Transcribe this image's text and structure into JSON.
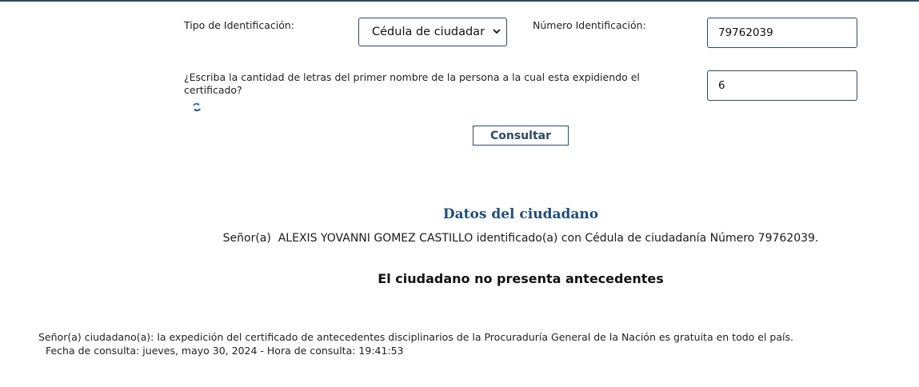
{
  "form": {
    "id_type_label": "Tipo de Identificación:",
    "id_type_selected": "Cédula de ciudadar",
    "id_number_label": "Número Identificación:",
    "id_number_value": "79762039",
    "question_label": "¿Escriba la cantidad de letras del primer nombre de la persona a la cual esta expidiendo el certificado?",
    "answer_value": "6",
    "submit_label": "Consultar"
  },
  "result": {
    "title": "Datos del ciudadano",
    "citizen_text": "Señor(a)  ALEXIS YOVANNI GOMEZ CASTILLO identificado(a) con Cédula de ciudadanía Número 79762039.",
    "status_text": "El ciudadano no presenta antecedentes"
  },
  "footer": {
    "note": "Señor(a) ciudadano(a): la expedición del certificado de antecedentes disciplinarios de la Procuraduría General de la Nación es gratuita en todo el país.",
    "date_line": " Fecha de consulta: jueves, mayo 30, 2024 - Hora de consulta: 19:41:53"
  },
  "colors": {
    "accent": "#2d4a63",
    "title": "#1f4e7a"
  },
  "icons": {
    "refresh": "refresh-icon",
    "select_chevron": "chevron-down-icon"
  }
}
